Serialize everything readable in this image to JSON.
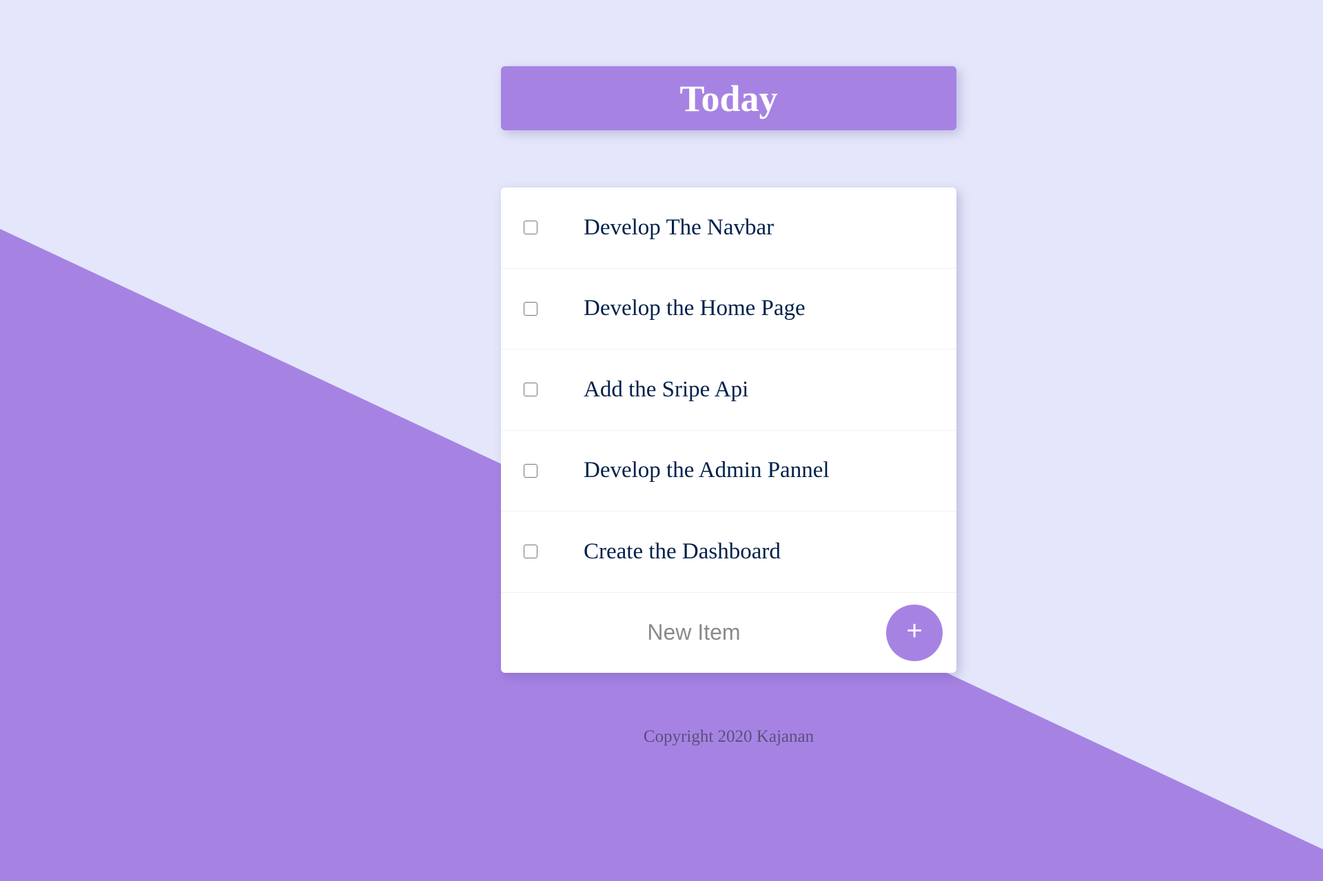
{
  "header": {
    "title": "Today"
  },
  "todo": {
    "items": [
      {
        "text": "Develop The Navbar",
        "checked": false
      },
      {
        "text": "Develop the Home Page",
        "checked": false
      },
      {
        "text": "Add the Sripe Api",
        "checked": false
      },
      {
        "text": "Develop the Admin Pannel",
        "checked": false
      },
      {
        "text": "Create the Dashboard",
        "checked": false
      }
    ],
    "new_item": {
      "placeholder": "New Item",
      "value": ""
    },
    "add_button_label": "+"
  },
  "footer": {
    "text": "Copyright 2020 Kajanan"
  },
  "colors": {
    "background": "#e4e7fb",
    "accent": "#a683e3",
    "item_text": "#00204a",
    "footer_text": "#5a4f7c"
  },
  "icons": {
    "add": "plus-icon"
  }
}
